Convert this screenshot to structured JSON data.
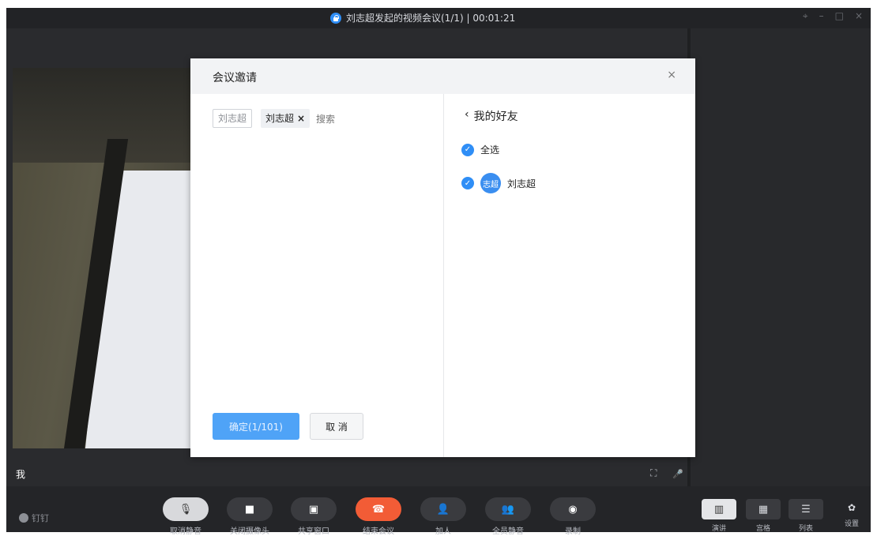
{
  "window": {
    "title": "刘志超发起的视频会议(1/1) | 00:01:21",
    "controls": [
      "⌖",
      "–",
      "□",
      "×"
    ]
  },
  "stage": {
    "self_label": "我",
    "fullscreen_icon": "⛶",
    "mic_icon": "🎤"
  },
  "brand": {
    "label": "钉钉"
  },
  "toolbar": [
    {
      "name": "unmute",
      "label": "取消静音",
      "icon": "🎙"
    },
    {
      "name": "camera",
      "label": "关闭摄像头",
      "icon": "■"
    },
    {
      "name": "share",
      "label": "共享窗口",
      "icon": "▣"
    },
    {
      "name": "end",
      "label": "结束会议",
      "icon": "☎"
    },
    {
      "name": "add",
      "label": "加人",
      "icon": "👤"
    },
    {
      "name": "mute-all",
      "label": "全员静音",
      "icon": "👥"
    },
    {
      "name": "record",
      "label": "录制",
      "icon": "◉"
    }
  ],
  "views": [
    {
      "name": "speaker",
      "label": "演讲",
      "icon": "▥"
    },
    {
      "name": "grid",
      "label": "宫格",
      "icon": "▦"
    },
    {
      "name": "list",
      "label": "列表",
      "icon": "☰"
    }
  ],
  "settings": {
    "label": "设置",
    "icon": "✿"
  },
  "dialog": {
    "title": "会议邀请",
    "close": "×",
    "tag_plain": "刘志超",
    "tag_selected": "刘志超",
    "tag_remove": "×",
    "search_placeholder": "搜索",
    "confirm": "确定(1/101)",
    "cancel": "取 消",
    "friends_back": "我的好友",
    "back_chevron": "‹",
    "select_all": "全选",
    "friend": {
      "avatar_text": "志超",
      "name": "刘志超"
    },
    "check_mark": "✓"
  },
  "colors": {
    "accent": "#2f8ef6",
    "end_call": "#f25c36"
  }
}
